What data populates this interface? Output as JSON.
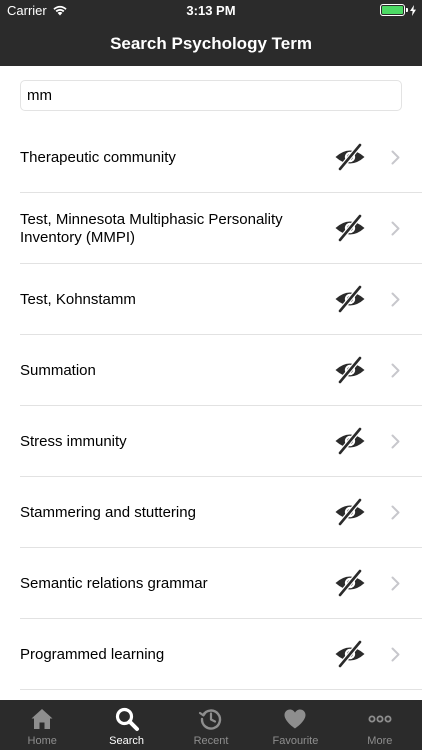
{
  "status_bar": {
    "carrier": "Carrier",
    "time": "3:13 PM"
  },
  "header": {
    "title": "Search Psychology Term"
  },
  "search": {
    "value": "mm",
    "placeholder": ""
  },
  "results": [
    {
      "label": "Therapeutic community"
    },
    {
      "label": "Test, Minnesota Multiphasic Personality Inventory (MMPI)"
    },
    {
      "label": "Test, Kohnstamm"
    },
    {
      "label": "Summation"
    },
    {
      "label": "Stress immunity"
    },
    {
      "label": "Stammering and stuttering"
    },
    {
      "label": "Semantic relations grammar"
    },
    {
      "label": "Programmed learning"
    }
  ],
  "row_icons": {
    "visibility": "eye-off-icon",
    "disclosure": "chevron-right-icon"
  },
  "tabbar": {
    "tabs": [
      {
        "label": "Home",
        "icon": "home-icon",
        "active": false
      },
      {
        "label": "Search",
        "icon": "search-icon",
        "active": true
      },
      {
        "label": "Recent",
        "icon": "history-icon",
        "active": false
      },
      {
        "label": "Favourite",
        "icon": "heart-icon",
        "active": false
      },
      {
        "label": "More",
        "icon": "more-icon",
        "active": false
      }
    ]
  },
  "colors": {
    "bar_background": "#2b2b2b",
    "battery": "#4cd964",
    "caret": "#3d7bf7",
    "tab_inactive": "#8e8e8e",
    "tab_active": "#ffffff"
  }
}
